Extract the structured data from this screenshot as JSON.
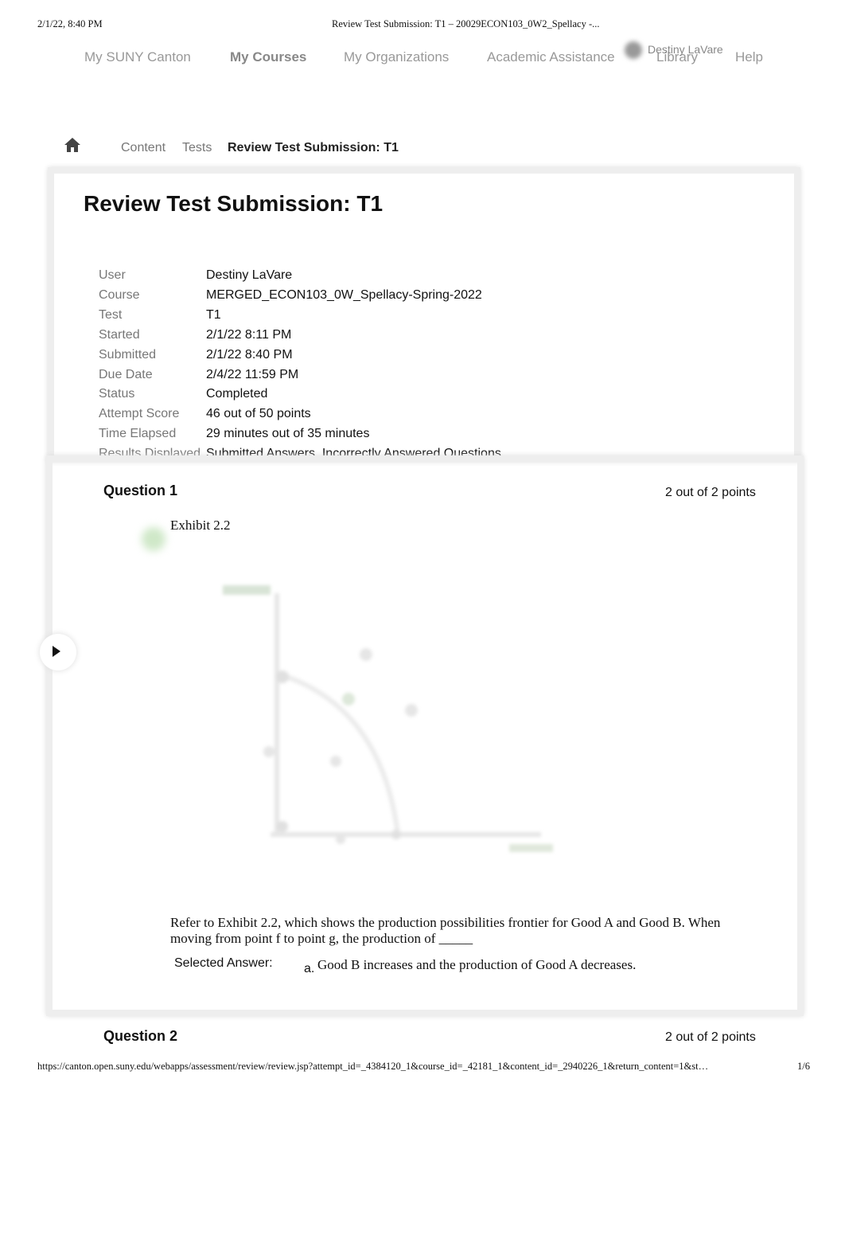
{
  "print_header": {
    "datetime": "2/1/22, 8:40 PM",
    "title": "Review Test Submission: T1 – 20029ECON103_0W2_Spellacy -..."
  },
  "nav": {
    "items": [
      "My SUNY Canton",
      "My Courses",
      "My Organizations",
      "Academic Assistance",
      "Library",
      "Help"
    ],
    "active": "My Courses",
    "user": "Destiny LaVare"
  },
  "breadcrumb": {
    "items": [
      "Content",
      "Tests",
      "Review Test Submission: T1"
    ],
    "home_icon": "home-icon"
  },
  "page_title": "Review Test Submission: T1",
  "details": [
    {
      "label": "User",
      "value": "Destiny LaVare"
    },
    {
      "label": "Course",
      "value": "MERGED_ECON103_0W_Spellacy-Spring-2022"
    },
    {
      "label": "Test",
      "value": "T1"
    },
    {
      "label": "Started",
      "value": "2/1/22 8:11 PM"
    },
    {
      "label": "Submitted",
      "value": "2/1/22 8:40 PM"
    },
    {
      "label": "Due Date",
      "value": "2/4/22 11:59 PM"
    },
    {
      "label": "Status",
      "value": "Completed"
    },
    {
      "label": "Attempt Score",
      "value": "46 out of 50 points"
    },
    {
      "label": "Time Elapsed",
      "value": "29 minutes out of 35 minutes"
    },
    {
      "label": "Results Displayed",
      "value": "Submitted Answers, Incorrectly Answered Questions"
    }
  ],
  "questions": [
    {
      "title": "Question 1",
      "points": "2 out of 2 points",
      "exhibit": "Exhibit 2.2",
      "text": "Refer to Exhibit 2.2, which shows the production possibilities frontier for Good A and Good B. When moving from point f to point g, the production of _____",
      "selected_label": "Selected Answer:",
      "answer_letter": "a.",
      "answer": "Good B increases and the production of Good A decreases."
    },
    {
      "title": "Question 2",
      "points": "2 out of 2 points"
    }
  ],
  "footer": {
    "url": "https://canton.open.suny.edu/webapps/assessment/review/review.jsp?attempt_id=_4384120_1&course_id=_42181_1&content_id=_2940226_1&return_content=1&st…",
    "page": "1/6"
  }
}
